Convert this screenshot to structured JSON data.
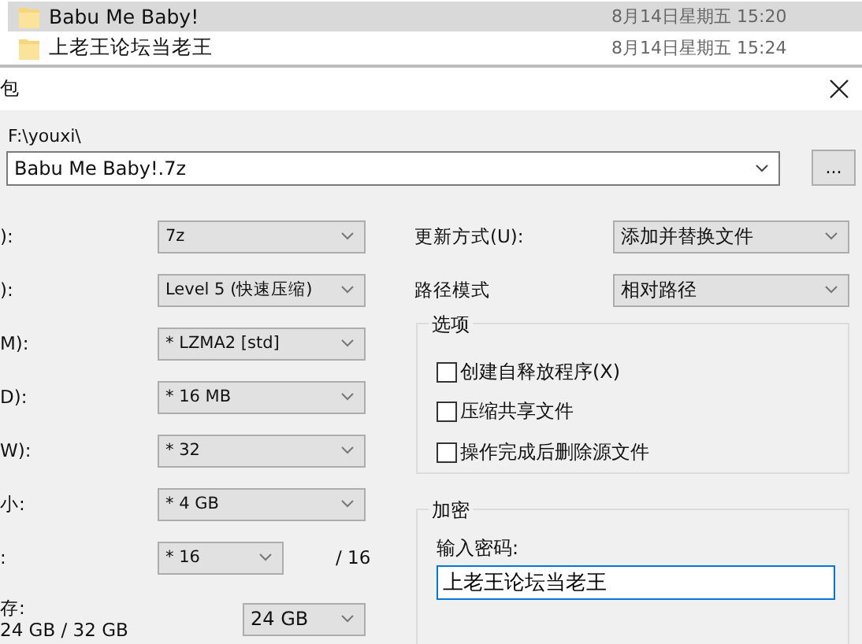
{
  "file_list": [
    {
      "name": "Babu Me Baby!",
      "modified": "8月14日星期五 15:20",
      "selected": true
    },
    {
      "name": "上老王论坛当老王",
      "modified": "8月14日星期五 15:24",
      "selected": false
    }
  ],
  "dialog": {
    "title": "包"
  },
  "archive": {
    "folder": "F:\\youxi\\",
    "name": "Babu Me Baby!.7z",
    "browse": "..."
  },
  "left_options": [
    {
      "kind": "combo",
      "label": "):",
      "value": "7z"
    },
    {
      "kind": "combo",
      "label": "):",
      "value": "Level 5 (快速压缩)"
    },
    {
      "kind": "combo",
      "label": "M):",
      "value": "* LZMA2 [std]"
    },
    {
      "kind": "combo",
      "label": "D):",
      "value": "* 16 MB"
    },
    {
      "kind": "combo",
      "label": "W):",
      "value": "* 32"
    },
    {
      "kind": "combo",
      "label": "小:",
      "value": "* 4 GB"
    },
    {
      "kind": "threads",
      "label": ":",
      "value": "* 16",
      "suffix": "/ 16"
    },
    {
      "kind": "memory",
      "label": "存:",
      "sublabel": "24 GB / 32 GB",
      "value": "24 GB"
    }
  ],
  "update_mode": {
    "label": "更新方式(U):",
    "value": "添加并替换文件"
  },
  "path_mode": {
    "label": "路径模式",
    "value": "相对路径"
  },
  "options": {
    "title": "选项",
    "checkboxes": [
      {
        "label": "创建自释放程序(X)",
        "checked": false
      },
      {
        "label": "压缩共享文件",
        "checked": false
      },
      {
        "label": "操作完成后删除源文件",
        "checked": false
      }
    ]
  },
  "encryption": {
    "title": "加密",
    "prompt": "输入密码:",
    "value": "上老王论坛当老王"
  }
}
